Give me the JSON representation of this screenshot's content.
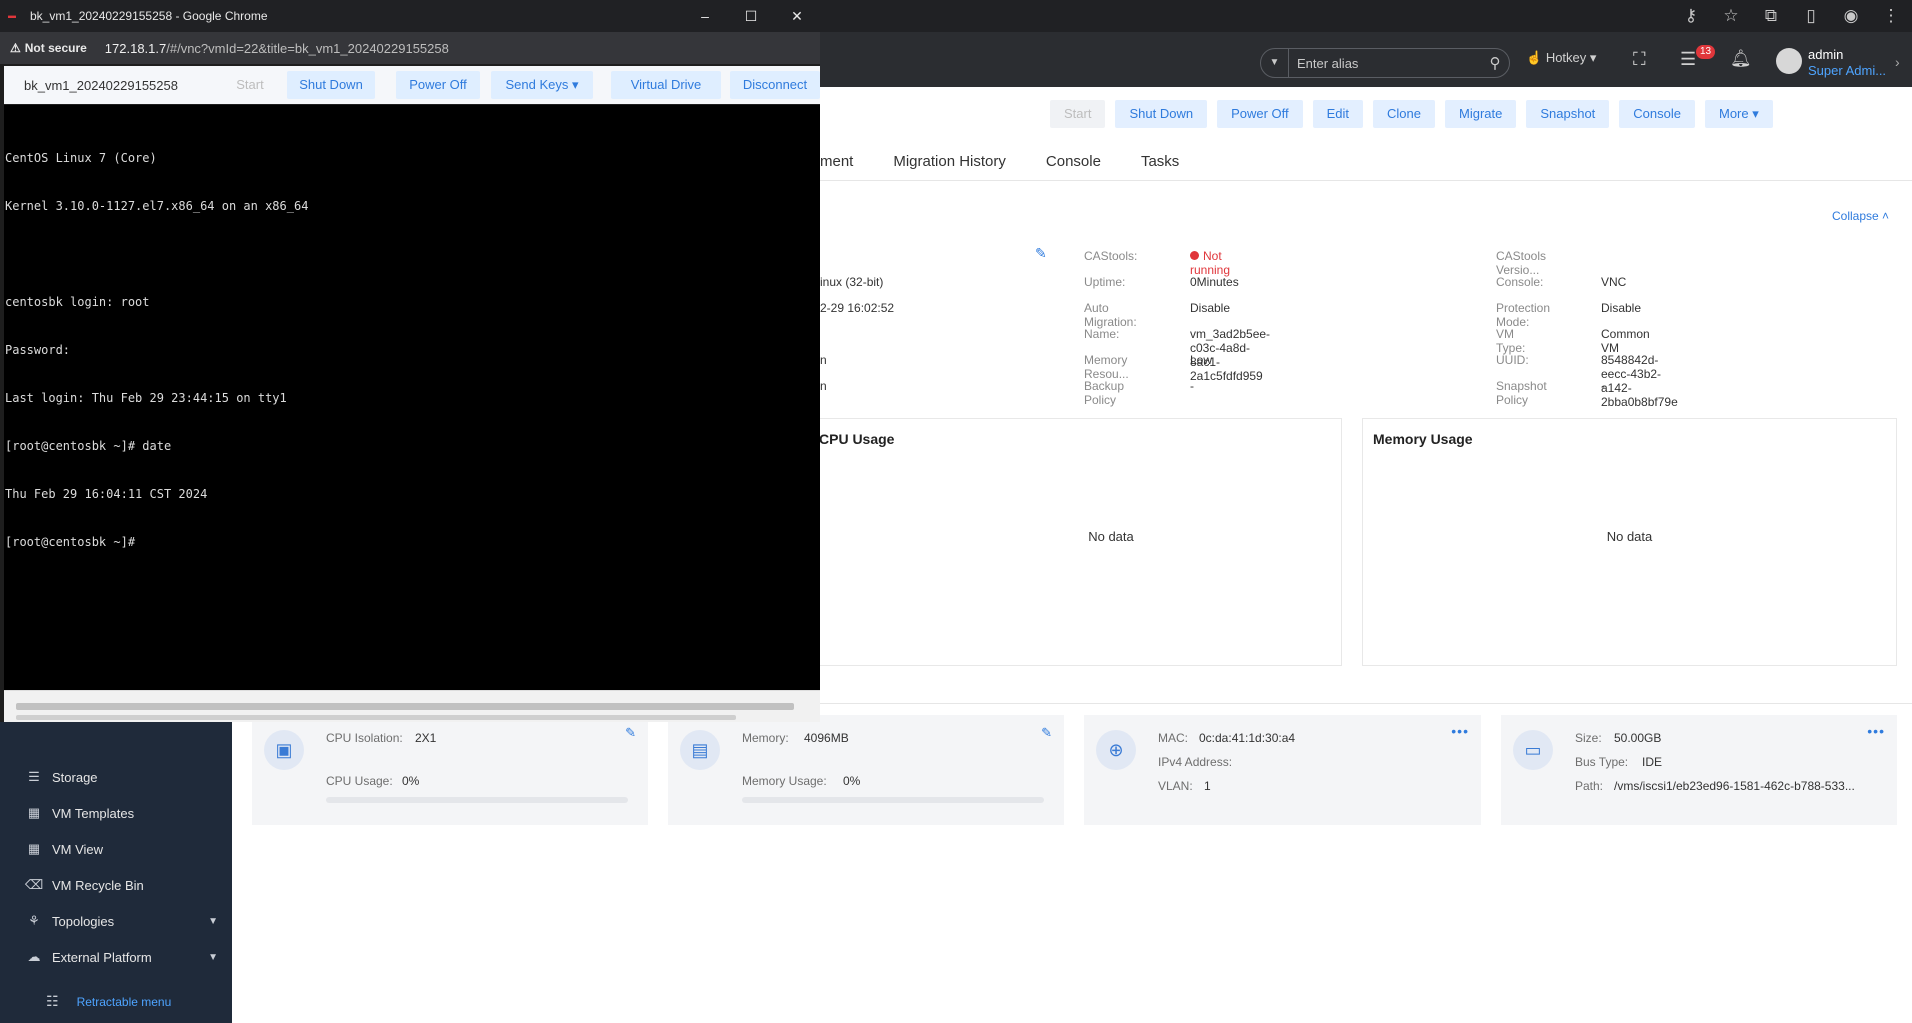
{
  "popup": {
    "title": "bk_vm1_20240229155258 - Google Chrome",
    "not_secure": "Not secure",
    "url_host": "172.18.1.7",
    "url_path": "/#/vnc?vmId=22&title=bk_vm1_20240229155258",
    "minimize": "–",
    "maximize": "☐",
    "close": "✕",
    "vnc": {
      "vm_name": "bk_vm1_20240229155258",
      "start": "Start",
      "shutdown": "Shut Down",
      "poweroff": "Power Off",
      "sendkeys": "Send Keys",
      "virtualdrive": "Virtual Drive",
      "disconnect": "Disconnect"
    },
    "terminal_lines": [
      "CentOS Linux 7 (Core)",
      "Kernel 3.10.0-1127.el7.x86_64 on an x86_64",
      "",
      "centosbk login: root",
      "Password:",
      "Last login: Thu Feb 29 23:44:15 on tty1",
      "[root@centosbk ~]# date",
      "Thu Feb 29 16:04:11 CST 2024",
      "[root@centosbk ~]#"
    ]
  },
  "header": {
    "alias_placeholder": "Enter alias",
    "hotkey": "Hotkey",
    "task_badge": "13",
    "user_name": "admin",
    "user_role": "Super Admi..."
  },
  "toolbar": {
    "start": "Start",
    "shutdown": "Shut Down",
    "poweroff": "Power Off",
    "edit": "Edit",
    "clone": "Clone",
    "migrate": "Migrate",
    "snapshot": "Snapshot",
    "console": "Console",
    "more": "More"
  },
  "tabs": [
    "ment",
    "Migration History",
    "Console",
    "Tasks"
  ],
  "collapse": "Collapse",
  "info": {
    "partial": [
      "inux (32-bit)",
      "2-29 16:02:52",
      "n",
      "n"
    ],
    "col1": [
      {
        "k": "CAStools:",
        "v": "Not running"
      },
      {
        "k": "Uptime:",
        "v": "0Minutes"
      },
      {
        "k": "Auto Migration:",
        "v": "Disable"
      },
      {
        "k": "Name:",
        "v": "vm_3ad2b5ee-c03c-4a8d-8ac1-2a1c5fdfd959"
      },
      {
        "k": "Memory Resou...",
        "v": "Low"
      },
      {
        "k": "Backup Policy",
        "v": "-"
      }
    ],
    "col2": [
      {
        "k": "CAStools Versio...",
        "v": ""
      },
      {
        "k": "Console:",
        "v": "VNC"
      },
      {
        "k": "Protection Mode:",
        "v": "Disable"
      },
      {
        "k": "VM Type:",
        "v": "Common VM"
      },
      {
        "k": "UUID:",
        "v": "8548842d-eecc-43b2-a142-2bba0b8bf79e"
      },
      {
        "k": "Snapshot Policy",
        "v": "-"
      }
    ]
  },
  "panels": {
    "cpu_title": "CPU Usage",
    "mem_title": "Memory Usage",
    "no_data": "No data"
  },
  "cards": {
    "cpu": {
      "iso_k": "CPU Isolation:",
      "iso_v": "2X1",
      "use_k": "CPU Usage:",
      "use_v": "0%",
      "usage_fraction": 0
    },
    "mem": {
      "mem_k": "Memory:",
      "mem_v": "4096MB",
      "use_k": "Memory Usage:",
      "use_v": "0%",
      "usage_fraction": 0
    },
    "net": {
      "mac_k": "MAC:",
      "mac_v": "0c:da:41:1d:30:a4",
      "ip_k": "IPv4 Address:",
      "ip_v": "",
      "vlan_k": "VLAN:",
      "vlan_v": "1"
    },
    "disk": {
      "size_k": "Size:",
      "size_v": "50.00GB",
      "bus_k": "Bus Type:",
      "bus_v": "IDE",
      "path_k": "Path:",
      "path_v": "/vms/iscsi1/eb23ed96-1581-462c-b788-533..."
    }
  },
  "sidebar": {
    "items": [
      {
        "label": "Storage",
        "icon": "storage-icon"
      },
      {
        "label": "VM Templates",
        "icon": "template-icon"
      },
      {
        "label": "VM View",
        "icon": "view-icon"
      },
      {
        "label": "VM Recycle Bin",
        "icon": "recycle-bin-icon"
      },
      {
        "label": "Topologies",
        "icon": "topology-icon"
      },
      {
        "label": "External Platform",
        "icon": "external-platform-icon"
      }
    ],
    "retract": "Retractable menu"
  }
}
